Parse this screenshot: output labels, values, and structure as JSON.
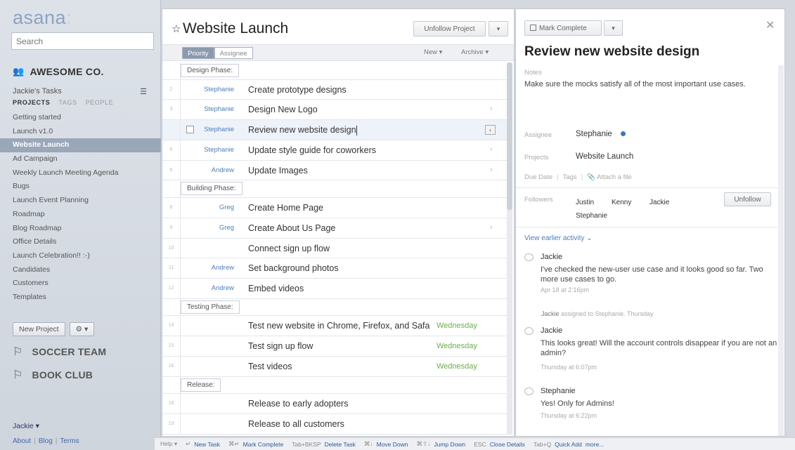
{
  "sidebar": {
    "logo": "asana",
    "logo_dots": ":",
    "search_placeholder": "Search",
    "workspace": "AWESOME CO.",
    "my_tasks": "Jackie's Tasks",
    "tabs": [
      "PROJECTS",
      "TAGS",
      "PEOPLE"
    ],
    "projects": [
      "Getting started",
      "Launch v1.0",
      "Website Launch",
      "Ad Campaign",
      "Weekly Launch Meeting Agenda",
      "Bugs",
      "Launch Event Planning",
      "Roadmap",
      "Blog Roadmap",
      "Office Details",
      "Launch Celebration!! :-)",
      "Candidates",
      "Customers",
      "Templates"
    ],
    "selected_project_index": 2,
    "new_project_label": "New Project",
    "settings_label": "⚙ ▾",
    "teams": [
      "SOCCER TEAM",
      "BOOK CLUB"
    ],
    "user_menu": "Jackie ▾",
    "footer_links": [
      "About",
      "Blog",
      "Terms"
    ]
  },
  "project": {
    "title": "Website Launch",
    "unfollow_label": "Unfollow Project",
    "sort_options": [
      "Priority",
      "Assignee"
    ],
    "new_label": "New ▾",
    "archive_label": "Archive ▾",
    "groups": [
      {
        "section": "Design Phase:",
        "tasks": [
          {
            "num": "2",
            "assignee": "Stephanie",
            "name": "Create prototype designs",
            "due": "",
            "chevron": false
          },
          {
            "num": "3",
            "assignee": "Stephanie",
            "name": "Design New Logo",
            "due": "",
            "chevron": true
          },
          {
            "num": "",
            "assignee": "Stephanie",
            "name": "Review new website design",
            "due": "",
            "chevron": false,
            "selected": true
          },
          {
            "num": "5",
            "assignee": "Stephanie",
            "name": "Update style guide for coworkers",
            "due": "",
            "chevron": true
          },
          {
            "num": "6",
            "assignee": "Andrew",
            "name": "Update Images",
            "due": "",
            "chevron": true
          }
        ]
      },
      {
        "section": "Building Phase:",
        "tasks": [
          {
            "num": "8",
            "assignee": "Greg",
            "name": "Create Home Page",
            "due": "",
            "chevron": false
          },
          {
            "num": "9",
            "assignee": "Greg",
            "name": "Create About Us Page",
            "due": "",
            "chevron": true
          },
          {
            "num": "10",
            "assignee": "",
            "name": "Connect sign up flow",
            "due": "",
            "chevron": false
          },
          {
            "num": "11",
            "assignee": "Andrew",
            "name": "Set background photos",
            "due": "",
            "chevron": false
          },
          {
            "num": "12",
            "assignee": "Andrew",
            "name": "Embed videos",
            "due": "",
            "chevron": false
          }
        ]
      },
      {
        "section": "Testing Phase:",
        "tasks": [
          {
            "num": "14",
            "assignee": "",
            "name": "Test new website in Chrome, Firefox, and Safa",
            "due": "Wednesday",
            "chevron": false
          },
          {
            "num": "15",
            "assignee": "",
            "name": "Test sign up flow",
            "due": "Wednesday",
            "chevron": false
          },
          {
            "num": "16",
            "assignee": "",
            "name": "Test videos",
            "due": "Wednesday",
            "chevron": false
          }
        ]
      },
      {
        "section": "Release:",
        "tasks": [
          {
            "num": "18",
            "assignee": "",
            "name": "Release to early adopters",
            "due": "",
            "chevron": false
          },
          {
            "num": "19",
            "assignee": "",
            "name": "Release to all customers",
            "due": "",
            "chevron": false
          }
        ]
      }
    ]
  },
  "details": {
    "mark_complete_label": "Mark Complete",
    "title": "Review new website design",
    "notes_label": "Notes",
    "notes": "Make sure the mocks satisfy all of the most important use cases.",
    "assignee_label": "Assignee",
    "assignee": "Stephanie",
    "projects_label": "Projects",
    "project": "Website Launch",
    "due_date_label": "Due Date",
    "tags_label": "Tags",
    "attach_label": "Attach a file",
    "followers_label": "Followers",
    "followers": [
      "Justin",
      "Kenny",
      "Jackie",
      "Stephanie"
    ],
    "unfollow_label": "Unfollow",
    "earlier_activity": "View earlier activity",
    "comments": [
      {
        "author": "Jackie",
        "body": "I've checked the new-user use case and it looks good so far.  Two more use cases to go.",
        "time": "Apr 18 at 2:16pm"
      },
      {
        "author": "Jackie",
        "body": "This looks great! Will the account controls disappear if you are not an admin?",
        "time": "Thursday at 6:07pm"
      },
      {
        "author": "Stephanie",
        "body": "Yes! Only for Admins!",
        "time": "Thursday at 6:22pm"
      }
    ],
    "assignment_note": {
      "who": "Jackie",
      "text": "assigned to Stephanie.",
      "when": "Thursday"
    }
  },
  "shortcuts": [
    {
      "key": "Help ▾",
      "action": ""
    },
    {
      "key": "↵",
      "action": "New Task"
    },
    {
      "key": "⌘↵",
      "action": "Mark Complete"
    },
    {
      "key": "Tab+BKSP",
      "action": "Delete Task"
    },
    {
      "key": "⌘↓",
      "action": "Move Down"
    },
    {
      "key": "⌘⇧↓",
      "action": "Jump Down"
    },
    {
      "key": "ESC",
      "action": "Close Details"
    },
    {
      "key": "Tab+Q",
      "action": "Quick Add"
    },
    {
      "key": "",
      "action": "more..."
    }
  ],
  "colors": {
    "link": "#4a7eb9",
    "due_green": "#6ab04c",
    "selected_project_bg": "#9aa7b9",
    "assignee_dot": "#3a78c2"
  }
}
